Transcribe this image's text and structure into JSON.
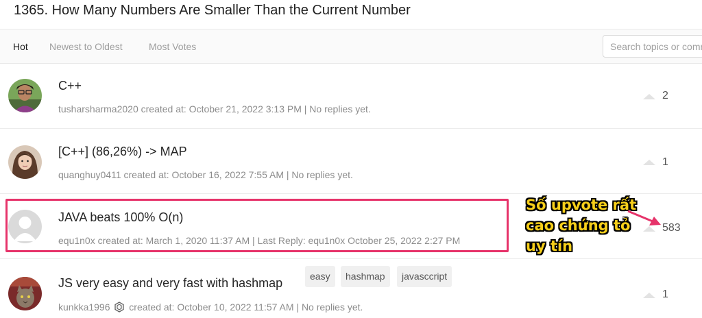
{
  "page_title": "1365. How Many Numbers Are Smaller Than the Current Number",
  "tabs": [
    {
      "label": "Hot",
      "active": true
    },
    {
      "label": "Newest to Oldest",
      "active": false
    },
    {
      "label": "Most Votes",
      "active": false
    }
  ],
  "search": {
    "placeholder": "Search topics or comments",
    "value": ""
  },
  "topics": [
    {
      "title": "C++",
      "author": "tusharsharma2020",
      "meta": "created at: October 21, 2022 3:13 PM | No replies yet.",
      "votes": "2",
      "tags": []
    },
    {
      "title": "[C++] (86,26%) -> MAP",
      "author": "quanghuy0411",
      "meta": "created at: October 16, 2022 7:55 AM | No replies yet.",
      "votes": "1",
      "tags": []
    },
    {
      "title": "JAVA beats 100% O(n)",
      "author": "equ1n0x",
      "meta": "created at: March 1, 2020 11:37 AM | Last Reply: equ1n0x October 25, 2022 2:27 PM",
      "votes": "583",
      "tags": []
    },
    {
      "title": "JS very easy and very fast with hashmap",
      "author": "kunkka1996",
      "meta": "created at: October 10, 2022 11:57 AM | No replies yet.",
      "votes": "1",
      "tags": [
        "easy",
        "hashmap",
        "javasccript"
      ]
    }
  ],
  "annotation": {
    "lines": [
      "Số upvote rất",
      "cao chứng tỏ",
      "uy tín"
    ],
    "color": "#f7cf1a"
  },
  "colors": {
    "highlight": "#e6336a",
    "text": "#262626",
    "muted": "#8c8c8c"
  }
}
